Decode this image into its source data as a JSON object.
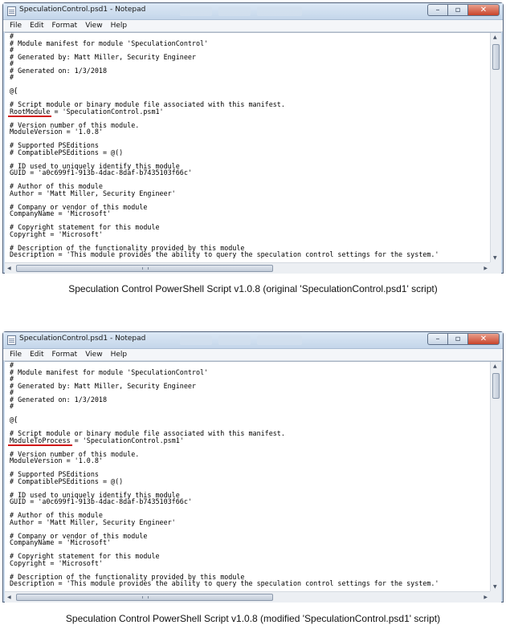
{
  "menu": [
    "File",
    "Edit",
    "Format",
    "View",
    "Help"
  ],
  "windows": [
    {
      "title": "SpeculationControl.psd1 - Notepad",
      "caption": "Speculation Control PowerShell Script v1.0.8 (original 'SpeculationControl.psd1' script)",
      "highlight_text": "RootModule",
      "lines": [
        "#",
        "# Module manifest for module 'SpeculationControl'",
        "#",
        "# Generated by: Matt Miller, Security Engineer",
        "#",
        "# Generated on: 1/3/2018",
        "#",
        "",
        "@{",
        "",
        "# Script module or binary module file associated with this manifest.",
        "RootModule = 'SpeculationControl.psm1'",
        "",
        "# Version number of this module.",
        "ModuleVersion = '1.0.8'",
        "",
        "# Supported PSEditions",
        "# CompatiblePSEditions = @()",
        "",
        "# ID used to uniquely identify this module",
        "GUID = 'a0c699f1-913b-4dac-8daf-b7435103f66c'",
        "",
        "# Author of this module",
        "Author = 'Matt Miller, Security Engineer'",
        "",
        "# Company or vendor of this module",
        "CompanyName = 'Microsoft'",
        "",
        "# Copyright statement for this module",
        "Copyright = 'Microsoft'",
        "",
        "# Description of the functionality provided by this module",
        "Description = 'This module provides the ability to query the speculation control settings for the system.'"
      ]
    },
    {
      "title": "SpeculationControl.psd1 - Notepad",
      "caption": "Speculation Control PowerShell Script v1.0.8 (modified 'SpeculationControl.psd1' script)",
      "highlight_text": "ModuleToProcess",
      "lines": [
        "#",
        "# Module manifest for module 'SpeculationControl'",
        "#",
        "# Generated by: Matt Miller, Security Engineer",
        "#",
        "# Generated on: 1/3/2018",
        "#",
        "",
        "@{",
        "",
        "# Script module or binary module file associated with this manifest.",
        "ModuleToProcess = 'SpeculationControl.psm1'",
        "",
        "# Version number of this module.",
        "ModuleVersion = '1.0.8'",
        "",
        "# Supported PSEditions",
        "# CompatiblePSEditions = @()",
        "",
        "# ID used to uniquely identify this module",
        "GUID = 'a0c699f1-913b-4dac-8daf-b7435103f66c'",
        "",
        "# Author of this module",
        "Author = 'Matt Miller, Security Engineer'",
        "",
        "# Company or vendor of this module",
        "CompanyName = 'Microsoft'",
        "",
        "# Copyright statement for this module",
        "Copyright = 'Microsoft'",
        "",
        "# Description of the functionality provided by this module",
        "Description = 'This module provides the ability to query the speculation control settings for the system.'"
      ]
    }
  ]
}
